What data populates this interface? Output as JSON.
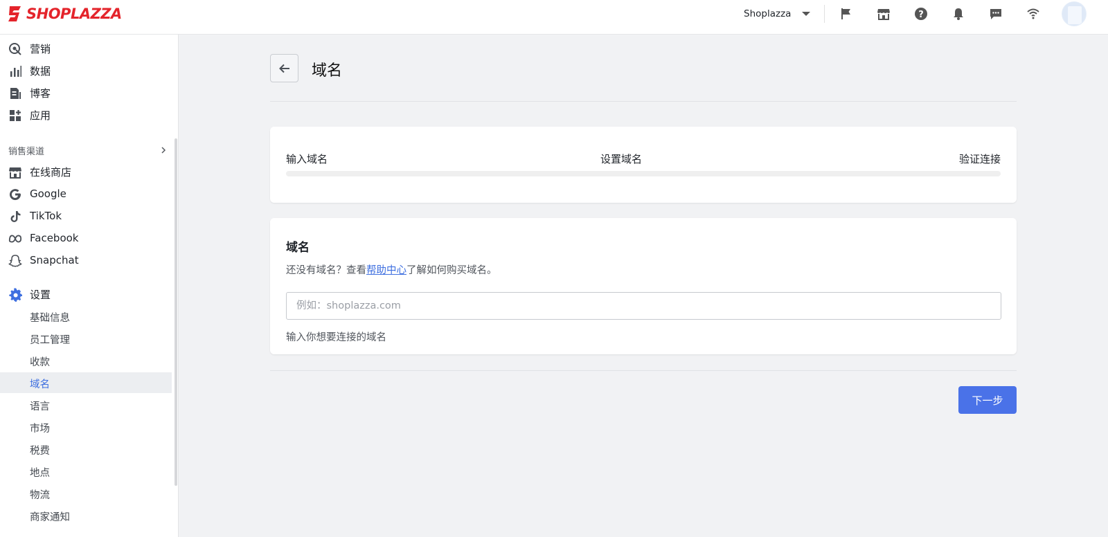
{
  "app": {
    "brand": "SHOPLAZZA",
    "brand_color": "#e4242b",
    "accent_color": "#4a72e8"
  },
  "topbar": {
    "store_name": "Shoplazza",
    "icons": [
      "flag-icon",
      "store-icon",
      "help-icon",
      "bell-icon",
      "message-icon",
      "wifi-icon"
    ]
  },
  "sidebar": {
    "main_items": [
      {
        "label": "营销",
        "icon": "marketing-icon"
      },
      {
        "label": "数据",
        "icon": "bar-chart-icon"
      },
      {
        "label": "博客",
        "icon": "blog-icon"
      },
      {
        "label": "应用",
        "icon": "apps-icon"
      }
    ],
    "sales_channels_title": "销售渠道",
    "channels": [
      {
        "label": "在线商店",
        "icon": "store-icon"
      },
      {
        "label": "Google",
        "icon": "google-icon"
      },
      {
        "label": "TikTok",
        "icon": "tiktok-icon"
      },
      {
        "label": "Facebook",
        "icon": "meta-icon"
      },
      {
        "label": "Snapchat",
        "icon": "snapchat-icon"
      }
    ],
    "settings": {
      "label": "设置",
      "icon": "gear-icon"
    },
    "settings_items": [
      {
        "label": "基础信息"
      },
      {
        "label": "员工管理"
      },
      {
        "label": "收款"
      },
      {
        "label": "域名",
        "active": true
      },
      {
        "label": "语言"
      },
      {
        "label": "市场"
      },
      {
        "label": "税费"
      },
      {
        "label": "地点"
      },
      {
        "label": "物流"
      },
      {
        "label": "商家通知"
      }
    ]
  },
  "page": {
    "title": "域名",
    "steps": [
      "输入域名",
      "设置域名",
      "验证连接"
    ],
    "progress": 0,
    "domain_card": {
      "heading": "域名",
      "desc_before": "还没有域名？查看",
      "desc_link": "帮助中心",
      "desc_after": "了解如何购买域名。",
      "input_placeholder": "例如：shoplazza.com",
      "input_value": "",
      "hint": "输入你想要连接的域名"
    },
    "next_button": "下一步"
  }
}
